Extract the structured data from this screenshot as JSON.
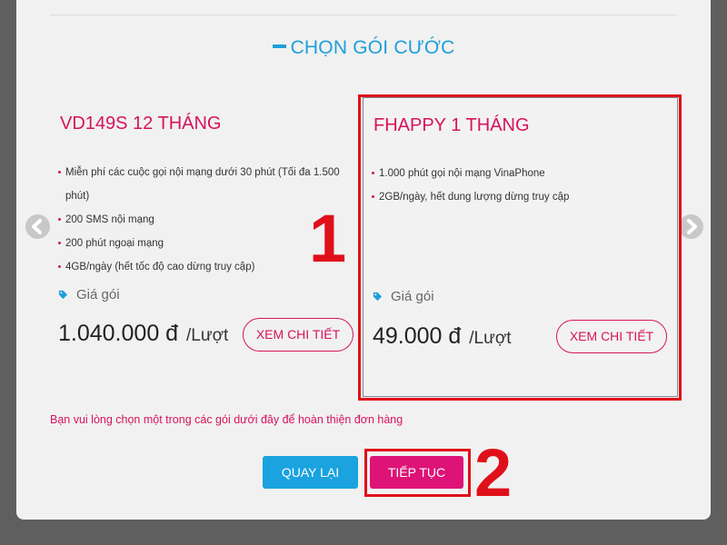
{
  "section_title": "CHỌN GÓI CƯỚC",
  "packages": [
    {
      "name": "VD149S 12 THÁNG",
      "features": [
        "Miễn phí các cuộc gọi nội mạng dưới 30 phút (Tối đa 1.500 phút)",
        "200 SMS nội mạng",
        "200 phút ngoại mạng",
        "4GB/ngày (hết tốc độ cao dừng truy cập)"
      ],
      "price_label": "Giá gói",
      "price": "1.040.000 đ",
      "price_unit": "/Lượt",
      "detail_button": "XEM CHI TIẾT"
    },
    {
      "name": "FHAPPY 1 THÁNG",
      "features": [
        "1.000 phút gọi nội mạng VinaPhone",
        "2GB/ngày, hết dung lượng dừng truy cập"
      ],
      "price_label": "Giá gói",
      "price": "49.000 đ",
      "price_unit": "/Lượt",
      "detail_button": "XEM CHI TIẾT"
    }
  ],
  "note": "Bạn vui lòng chọn một trong các gói dưới đây để hoàn thiện đơn hàng",
  "buttons": {
    "back": "QUAY LẠI",
    "next": "TIẾP TỤC"
  },
  "annotations": {
    "step1": "1",
    "step2": "2"
  },
  "colors": {
    "brand_pink": "#d6145b",
    "brand_blue": "#1e9fdb",
    "next_button": "#dd1377",
    "back_button": "#1aa3df",
    "annotation_red": "#e0101a"
  },
  "icons": [
    "chevron-left-icon",
    "chevron-right-icon",
    "price-tag-icon"
  ]
}
